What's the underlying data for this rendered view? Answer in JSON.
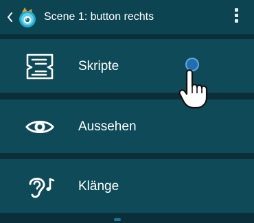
{
  "header": {
    "title": "Scene 1: button rechts",
    "back_icon": "chevron-left-icon",
    "app_icon": "pocket-code-cat-icon",
    "menu_icon": "overflow-menu-icon"
  },
  "menu": {
    "items": [
      {
        "label": "Skripte",
        "icon": "scripts-icon"
      },
      {
        "label": "Aussehen",
        "icon": "eye-icon"
      },
      {
        "label": "Klänge",
        "icon": "ear-music-icon"
      }
    ]
  },
  "colors": {
    "row_bg": "#0f4a58",
    "topbar_bg": "#0d4452",
    "background": "#0b2e39",
    "text": "#ffffff",
    "touch_dot": "#1f6fb2"
  },
  "overlay": {
    "pointer_icon": "pointing-hand-icon",
    "touch_indicator": "touch-dot"
  }
}
